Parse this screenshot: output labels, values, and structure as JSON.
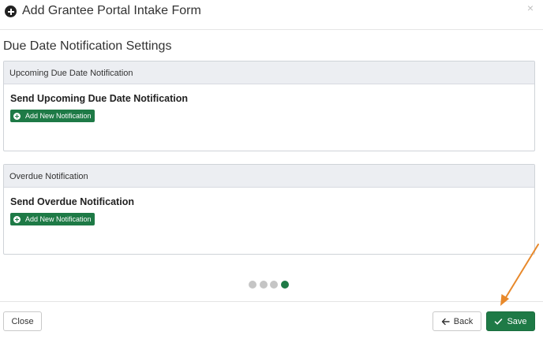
{
  "modal": {
    "title": "Add Grantee Portal Intake Form",
    "close_glyph": "×"
  },
  "section": {
    "title": "Due Date Notification Settings"
  },
  "panels": {
    "upcoming": {
      "heading": "Upcoming Due Date Notification",
      "subtitle": "Send Upcoming Due Date Notification",
      "button_label": "Add New Notification"
    },
    "overdue": {
      "heading": "Overdue Notification",
      "subtitle": "Send Overdue Notification",
      "button_label": "Add New Notification"
    }
  },
  "wizard": {
    "total_steps": 4,
    "current_step": 4
  },
  "footer": {
    "close_label": "Close",
    "back_label": "Back",
    "save_label": "Save"
  },
  "colors": {
    "accent": "#1e7a46",
    "annotation_arrow": "#e8892b"
  },
  "icons": {
    "title": "plus-circle-icon",
    "add": "plus-circle-icon",
    "back": "arrow-left-icon",
    "save": "check-icon"
  }
}
